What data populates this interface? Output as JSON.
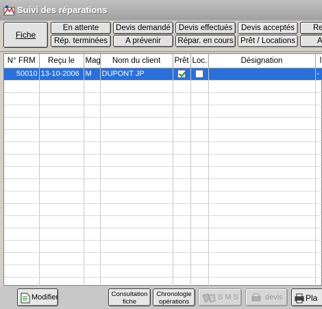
{
  "window": {
    "title": "Suivi des réparations"
  },
  "toolbar": {
    "fiche": "Fiche",
    "row1": [
      "En attente",
      "Devis demandé",
      "Devis effectués",
      "Devis acceptés",
      "Re"
    ],
    "row2": [
      "Rép. terminées",
      "A prévenir",
      "Répar. en cours",
      "Prêt / Locations",
      "A"
    ]
  },
  "grid": {
    "columns": [
      "N° FRM",
      "Reçu le",
      "Mag",
      "Nom du client",
      "Prêt",
      "Loc.",
      "Désignation",
      "l"
    ],
    "rows": [
      {
        "frm": "50010",
        "recu": "13-10-2006",
        "mag": "M",
        "client": "DUPONT JP",
        "pret": true,
        "loc": false,
        "designation": "",
        "last": "-"
      }
    ]
  },
  "bottom": {
    "modifier": "Modifier",
    "consultation": [
      "Consultation",
      "fiche"
    ],
    "chronologie": [
      "Chronologie",
      "opérations"
    ],
    "sms": "S M S",
    "devis": "devis",
    "plan": "Pla"
  }
}
